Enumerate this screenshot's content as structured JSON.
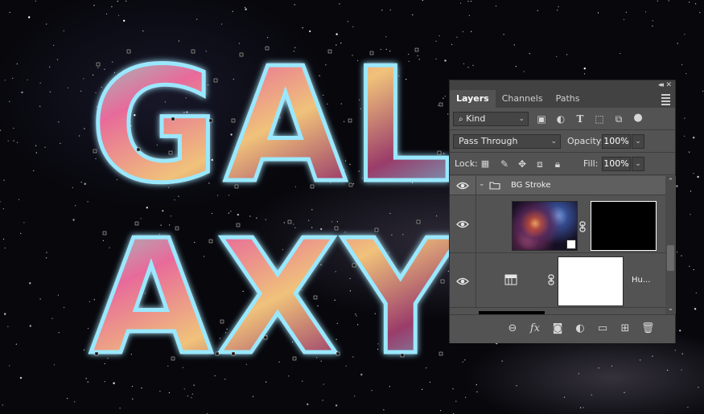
{
  "canvas": {
    "artwork_lines": [
      "GAL",
      "AXY"
    ]
  },
  "panel": {
    "tabs": [
      {
        "label": "Layers",
        "active": true
      },
      {
        "label": "Channels",
        "active": false
      },
      {
        "label": "Paths",
        "active": false
      }
    ],
    "filter": {
      "kind_label": "Kind"
    },
    "blend_mode": "Pass Through",
    "opacity_label": "Opacity:",
    "opacity_value": "100%",
    "lock_label": "Lock:",
    "fill_label": "Fill:",
    "fill_value": "100%",
    "layers": [
      {
        "name": "BG Stroke",
        "type": "group",
        "visible": true,
        "expanded": true
      },
      {
        "name": "",
        "type": "smart-object-with-mask",
        "visible": true
      },
      {
        "name": "Hu...",
        "type": "adjustment-hue-saturation",
        "visible": true
      }
    ],
    "bottom_icons": [
      "link-icon",
      "fx-icon",
      "mask-icon",
      "adjustment-icon",
      "folder-icon",
      "new-layer-icon",
      "trash-icon"
    ]
  },
  "colors": {
    "panel_bg": "#535353",
    "panel_dark": "#424242",
    "canvas_bg": "#07070c"
  }
}
